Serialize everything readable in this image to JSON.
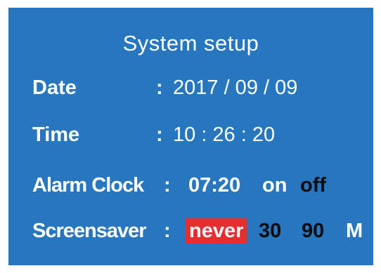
{
  "screen": {
    "title": "System setup",
    "colors": {
      "background": "#2677bf",
      "text": "#ffffff",
      "inactive_option": "#0a0a0a",
      "selected_highlight": "#e62e2e"
    }
  },
  "date": {
    "label": "Date",
    "separator": ":",
    "value": "2017 / 09 / 09"
  },
  "time": {
    "label": "Time",
    "separator": ":",
    "value": "10 : 26 : 20"
  },
  "alarm": {
    "label": "Alarm Clock",
    "separator": ":",
    "time": "07:20",
    "option_on": "on",
    "option_off": "off"
  },
  "screensaver": {
    "label": "Screensaver",
    "separator": ":",
    "options": [
      "never",
      "30",
      "90"
    ],
    "selected": "never",
    "unit": "M"
  }
}
